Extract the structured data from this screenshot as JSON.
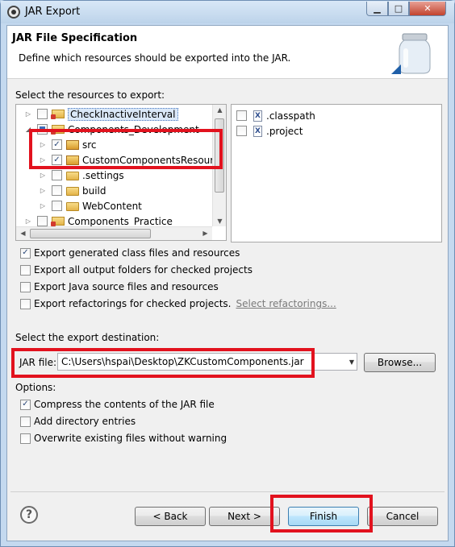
{
  "window": {
    "title": "JAR Export",
    "controls": {
      "minimize": "▁",
      "maximize": "□",
      "close": "✕"
    }
  },
  "header": {
    "title": "JAR File Specification",
    "description": "Define which resources should be exported into the JAR."
  },
  "resources": {
    "label": "Select the resources to export:",
    "tree": [
      {
        "label": "CheckInactiveInterval",
        "icon": "project-icon",
        "state": "unchecked",
        "expander": "▷"
      },
      {
        "label": "Components_Development",
        "icon": "project-icon",
        "state": "partial",
        "expander": "◢"
      },
      {
        "label": "src",
        "icon": "package-folder-icon",
        "state": "checked",
        "expander": "▷"
      },
      {
        "label": "CustomComponentsResources",
        "icon": "package-folder-icon",
        "state": "checked",
        "expander": "▷"
      },
      {
        "label": ".settings",
        "icon": "folder-icon",
        "state": "unchecked",
        "expander": "▷"
      },
      {
        "label": "build",
        "icon": "folder-icon",
        "state": "unchecked",
        "expander": "▷"
      },
      {
        "label": "WebContent",
        "icon": "folder-icon",
        "state": "unchecked",
        "expander": "▷"
      },
      {
        "label": "Components_Practice",
        "icon": "project-icon",
        "state": "unchecked",
        "expander": "▷"
      }
    ],
    "files": [
      {
        "label": ".classpath",
        "state": "unchecked"
      },
      {
        "label": ".project",
        "state": "unchecked"
      }
    ]
  },
  "export_options": [
    {
      "label": "Export generated class files and resources",
      "checked": true
    },
    {
      "label": "Export all output folders for checked projects",
      "checked": false
    },
    {
      "label": "Export Java source files and resources",
      "checked": false
    },
    {
      "label": "Export refactorings for checked projects.",
      "checked": false,
      "link": "Select refactorings..."
    }
  ],
  "destination": {
    "label": "Select the export destination:",
    "jar_label": "JAR file:",
    "jar_value": "C:\\Users\\hspai\\Desktop\\ZKCustomComponents.jar",
    "browse_label": "Browse..."
  },
  "options": {
    "label": "Options:",
    "items": [
      {
        "label": "Compress the contents of the JAR file",
        "checked": true
      },
      {
        "label": "Add directory entries",
        "checked": false
      },
      {
        "label": "Overwrite existing files without warning",
        "checked": false
      }
    ]
  },
  "buttons": {
    "help": "?",
    "back": "< Back",
    "next": "Next >",
    "finish": "Finish",
    "cancel": "Cancel"
  },
  "colors": {
    "highlight": "#e2121e",
    "link": "#7a7a7a"
  }
}
